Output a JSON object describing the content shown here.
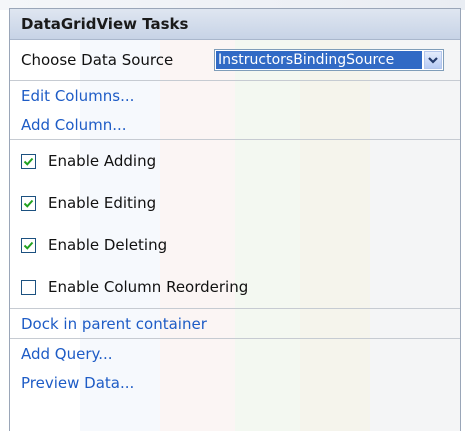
{
  "panel": {
    "title": "DataGridView Tasks"
  },
  "data_source": {
    "label": "Choose Data Source",
    "selected_value": "InstructorsBindingSource"
  },
  "links_top": [
    {
      "label": "Edit Columns..."
    },
    {
      "label": "Add Column..."
    }
  ],
  "checkboxes": [
    {
      "label": "Enable Adding",
      "checked": true
    },
    {
      "label": "Enable Editing",
      "checked": true
    },
    {
      "label": "Enable Deleting",
      "checked": true
    },
    {
      "label": "Enable Column Reordering",
      "checked": false
    }
  ],
  "dock": {
    "label": "Dock in parent container"
  },
  "links_bottom": [
    {
      "label": "Add Query..."
    },
    {
      "label": "Preview Data..."
    }
  ],
  "colors": {
    "header_bg": "#c7d3e6",
    "link": "#1e5cc6",
    "selection": "#316ac5",
    "checkbox_border": "#1c5180",
    "checkmark": "#21a121"
  },
  "icons": {
    "combo_button": "chevron-down-icon",
    "checked_state": "checkmark-icon"
  }
}
